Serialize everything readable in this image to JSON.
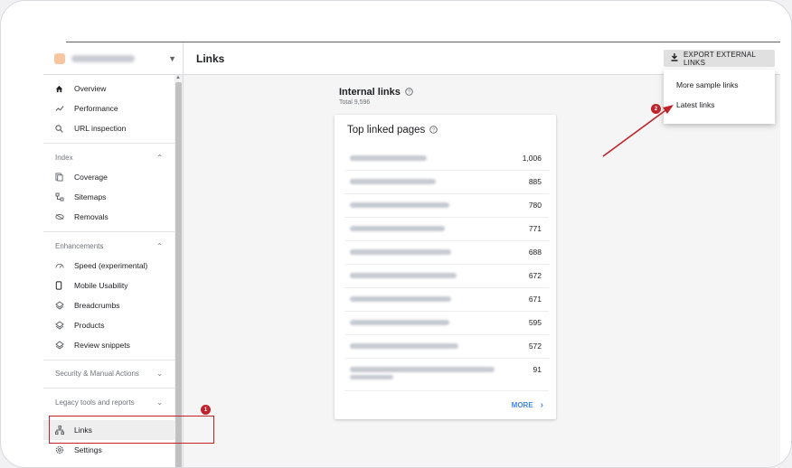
{
  "sidebar": {
    "nav_top": [
      {
        "icon": "home-icon",
        "label": "Overview"
      },
      {
        "icon": "performance-icon",
        "label": "Performance"
      },
      {
        "icon": "search-icon",
        "label": "URL inspection"
      }
    ],
    "index_label": "Index",
    "index_items": [
      {
        "icon": "coverage-icon",
        "label": "Coverage"
      },
      {
        "icon": "sitemap-icon",
        "label": "Sitemaps"
      },
      {
        "icon": "removals-icon",
        "label": "Removals"
      }
    ],
    "enhancements_label": "Enhancements",
    "enhancement_items": [
      {
        "icon": "speed-icon",
        "label": "Speed (experimental)"
      },
      {
        "icon": "mobile-icon",
        "label": "Mobile Usability"
      },
      {
        "icon": "layers-icon",
        "label": "Breadcrumbs"
      },
      {
        "icon": "layers-icon",
        "label": "Products"
      },
      {
        "icon": "layers-icon",
        "label": "Review snippets"
      }
    ],
    "security_label": "Security & Manual Actions",
    "legacy_label": "Legacy tools and reports",
    "links_label": "Links",
    "settings_label": "Settings"
  },
  "header": {
    "title": "Links",
    "export_label": "EXPORT EXTERNAL LINKS"
  },
  "menu": {
    "items": [
      "More sample links",
      "Latest links"
    ]
  },
  "internal_links": {
    "title": "Internal links",
    "total": "Total 9,596"
  },
  "top_linked": {
    "title": "Top linked pages",
    "rows": [
      {
        "value": "1,006"
      },
      {
        "value": "885"
      },
      {
        "value": "780"
      },
      {
        "value": "771"
      },
      {
        "value": "688"
      },
      {
        "value": "672"
      },
      {
        "value": "671"
      },
      {
        "value": "595"
      },
      {
        "value": "572"
      },
      {
        "value": "91"
      }
    ],
    "more_label": "MORE"
  },
  "annotations": {
    "badge_1": "1",
    "badge_2": "2",
    "color": "#c0232c"
  }
}
